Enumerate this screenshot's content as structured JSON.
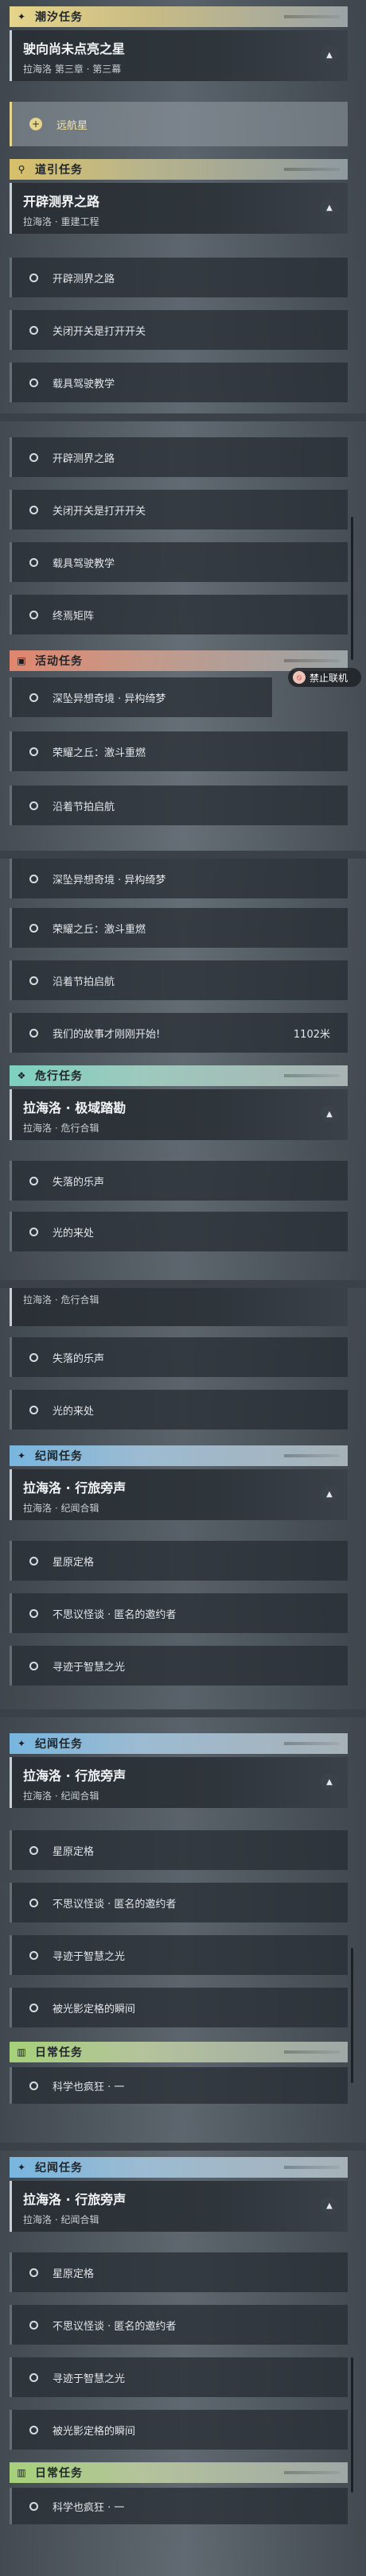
{
  "categories": {
    "tide": "潮汐任务",
    "guide": "道引任务",
    "event": "活动任务",
    "danger": "危行任务",
    "chronicle": "纪闻任务",
    "daily": "日常任务"
  },
  "tide_quest": {
    "title": "驶向尚未点亮之星",
    "subtitle": "拉海洛 第三章 · 第三幕",
    "active_item": "远航星"
  },
  "guide_quest": {
    "title": "开辟测界之路",
    "subtitle": "拉海洛 · 重建工程",
    "items": [
      "开辟测界之路",
      "关闭开关是打开开关",
      "载具驾驶教学",
      "终焉矩阵"
    ]
  },
  "event_items": [
    "深坠异想奇境 · 异构绮梦",
    "荣耀之丘：激斗重燃",
    "沿着节拍启航",
    "我们的故事才刚刚开始!"
  ],
  "event_distance": "1102米",
  "banner": "禁止联机",
  "danger_quest": {
    "title": "拉海洛 · 极域踏勘",
    "subtitle": "拉海洛 · 危行合辑",
    "items": [
      "失落的乐声",
      "光的来处"
    ]
  },
  "chronicle_quest": {
    "title": "拉海洛 · 行旅旁声",
    "subtitle": "拉海洛 · 纪闻合辑",
    "items": [
      "星原定格",
      "不思议怪谈 · 匿名的邀约者",
      "寻迹于智慧之光",
      "被光影定格的瞬间"
    ]
  },
  "daily_items": [
    "科学也疯狂 · 一"
  ],
  "icons": {
    "tide": "sparkle-icon",
    "guide": "location-pin-icon",
    "event": "calendar-icon",
    "danger": "danger-emblem-icon",
    "chronicle": "dispatch-icon",
    "daily": "book-icon",
    "toggle": "chevron-up-icon",
    "item": "circle-icon",
    "no_coop": "no-coop-icon"
  }
}
